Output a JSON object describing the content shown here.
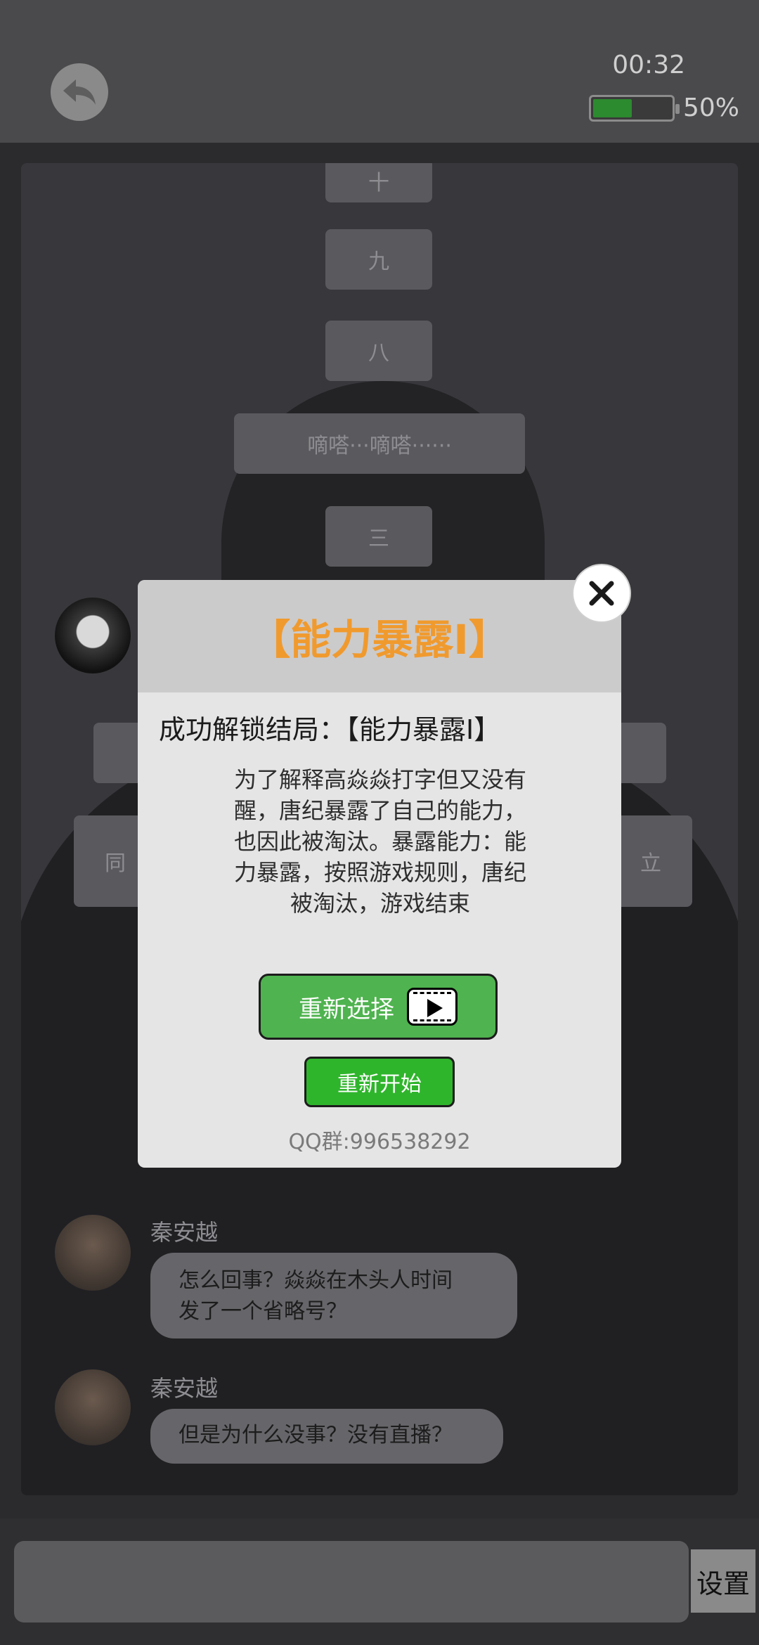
{
  "status": {
    "time": "00:32",
    "battery_percent_text": "50%",
    "battery_level": 0.5
  },
  "chat": {
    "countdown_pills": [
      "十",
      "九",
      "八",
      "嘀嗒···嘀嗒······",
      "三"
    ],
    "partial_pills": [
      "同",
      "立"
    ],
    "messages": [
      {
        "sender": "秦安越",
        "text_lines": [
          "怎么回事？焱焱在木头人时间",
          "发了一个省略号？"
        ]
      },
      {
        "sender": "秦安越",
        "text_lines": [
          "但是为什么没事？没有直播？"
        ]
      }
    ]
  },
  "modal": {
    "title": "【能力暴露Ⅰ】",
    "subtitle": "成功解锁结局：【能力暴露Ⅰ】",
    "description_lines": [
      "为了解释高焱焱打字但又没有",
      "醒，唐纪暴露了自己的能力，",
      "也因此被淘汰。暴露能力：能",
      "力暴露，按照游戏规则，唐纪",
      "被淘汰，游戏结束"
    ],
    "choose_again_label": "重新选择",
    "restart_label": "重新开始",
    "qq_group": "QQ群:996538292"
  },
  "bottom": {
    "settings_label": "设置"
  },
  "colors": {
    "title_orange": "#f09a2e",
    "button_green": "#4fb34f",
    "restart_green": "#2fb52c",
    "battery_green": "#2c8a2f"
  },
  "icons": {
    "back": "undo-arrow-icon",
    "close": "close-x-icon",
    "video": "video-play-icon"
  }
}
